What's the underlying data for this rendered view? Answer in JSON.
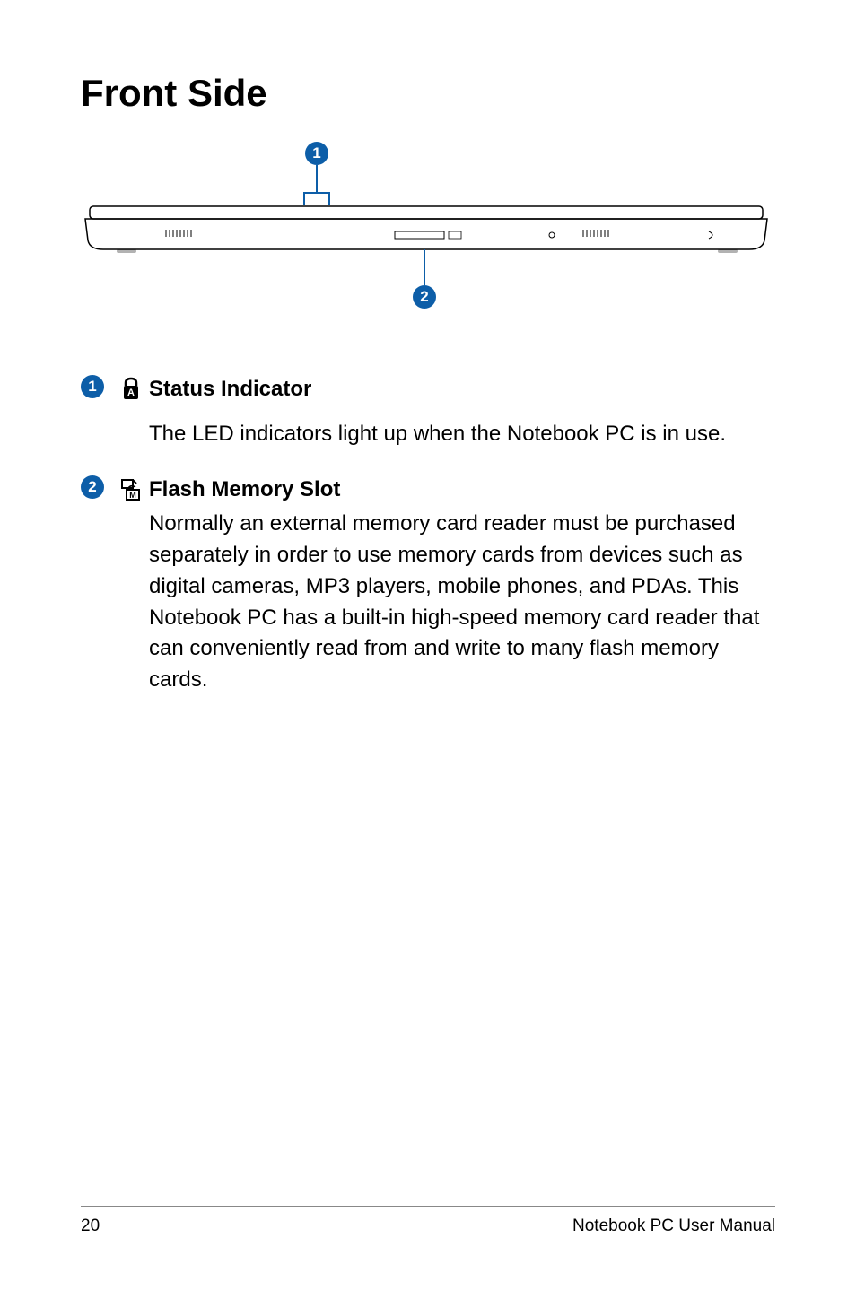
{
  "title": "Front Side",
  "callouts": {
    "num1": "1",
    "num2": "2"
  },
  "items": [
    {
      "num": "1",
      "icon": "lock-icon",
      "title": "Status Indicator",
      "desc": "The LED indicators light up when the Notebook PC is in use."
    },
    {
      "num": "2",
      "icon": "memory-card-icon",
      "title": "Flash Memory Slot",
      "desc": "Normally an external memory card reader must be purchased separately in order to use memory cards from devices such as digital cameras, MP3 players, mobile phones, and PDAs. This Notebook PC has a built-in high-speed memory card reader that can conveniently read from and write to many flash memory cards."
    }
  ],
  "footer": {
    "page": "20",
    "label": "Notebook PC User Manual"
  }
}
